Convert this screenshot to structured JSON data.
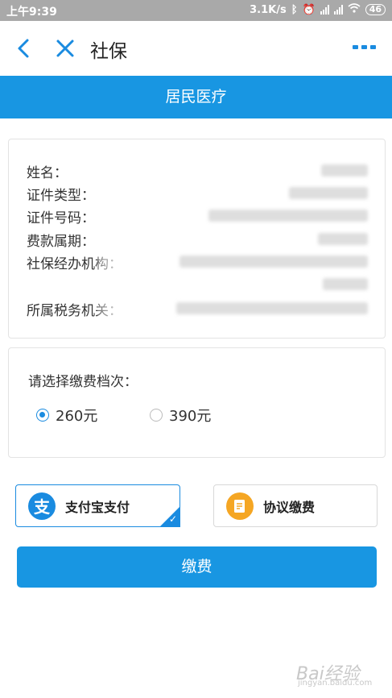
{
  "status_bar": {
    "time": "上午9:39",
    "speed": "3.1K/s",
    "battery": "46"
  },
  "nav": {
    "title": "社保",
    "back_icon": "chevron-left-icon",
    "close_icon": "close-icon",
    "more_icon": "more-dots-icon"
  },
  "banner": {
    "title": "居民医疗"
  },
  "info": {
    "rows": [
      {
        "label": "姓名："
      },
      {
        "label": "证件类型："
      },
      {
        "label": "证件号码："
      },
      {
        "label": "费款属期："
      },
      {
        "label": "社保经办机构："
      },
      {
        "label": "所属税务机关："
      }
    ]
  },
  "tier": {
    "prompt": "请选择缴费档次：",
    "options": [
      {
        "label": "260元",
        "selected": true
      },
      {
        "label": "390元",
        "selected": false
      }
    ]
  },
  "payment_methods": {
    "alipay": {
      "label": "支付宝支付",
      "icon": "alipay-icon",
      "icon_text": "支",
      "selected": true
    },
    "protocol": {
      "label": "协议缴费",
      "icon": "document-icon",
      "selected": false
    }
  },
  "submit": {
    "label": "缴费"
  },
  "watermark": {
    "text": "Bai经验",
    "sub": "jingyan.baidu.com"
  },
  "colors": {
    "accent": "#1896e2",
    "alipay": "#1a8be0",
    "protocol": "#f5a623",
    "status_bar": "#a9a9a9"
  }
}
